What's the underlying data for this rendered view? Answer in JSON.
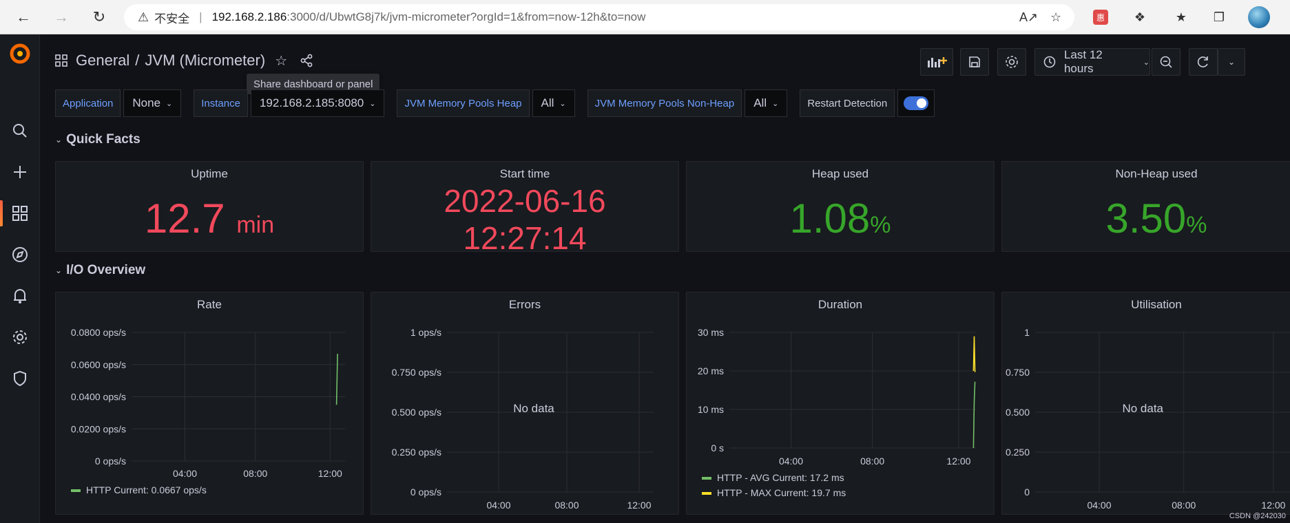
{
  "browser": {
    "insecure_label": "不安全",
    "url_host": "192.168.2.186",
    "url_path": ":3000/d/UbwtG8j7k/jvm-micrometer?orgId=1&from=now-12h&to=now",
    "ext_label": "惠"
  },
  "header": {
    "folder": "General",
    "title": "JVM (Micrometer)",
    "share_tooltip": "Share dashboard or panel",
    "time_range": "Last 12 hours"
  },
  "variables": [
    {
      "label": "Application",
      "value": "None"
    },
    {
      "label": "Instance",
      "value": "192.168.2.185:8080"
    },
    {
      "label": "JVM Memory Pools Heap",
      "value": "All"
    },
    {
      "label": "JVM Memory Pools Non-Heap",
      "value": "All"
    }
  ],
  "restart_detection": {
    "label": "Restart Detection",
    "enabled": true
  },
  "rows": {
    "quick_facts": "Quick Facts",
    "io_overview": "I/O Overview"
  },
  "stats": {
    "uptime": {
      "title": "Uptime",
      "value": "12.7",
      "unit": "min",
      "color": "#f2495c"
    },
    "start_time": {
      "title": "Start time",
      "line1": "2022-06-16",
      "line2": "12:27:14",
      "color": "#f2495c"
    },
    "heap_used": {
      "title": "Heap used",
      "value": "1.08",
      "unit": "%",
      "color": "#37a52a"
    },
    "nonheap_used": {
      "title": "Non-Heap used",
      "value": "3.50",
      "unit": "%",
      "color": "#37a52a"
    }
  },
  "chart_data": [
    {
      "type": "line",
      "title": "Rate",
      "x": [
        "04:00",
        "08:00",
        "12:00"
      ],
      "yticks": [
        "0.0800 ops/s",
        "0.0600 ops/s",
        "0.0400 ops/s",
        "0.0200 ops/s",
        "0 ops/s"
      ],
      "ylim": [
        0,
        0.08
      ],
      "series": [
        {
          "name": "HTTP",
          "legend": "HTTP  Current: 0.0667 ops/s",
          "color": "#73bf69",
          "points": [
            [
              0.96,
              0.035
            ],
            [
              0.965,
              0.0667
            ]
          ]
        }
      ]
    },
    {
      "type": "line",
      "title": "Errors",
      "x": [
        "04:00",
        "08:00",
        "12:00"
      ],
      "yticks": [
        "1 ops/s",
        "0.750 ops/s",
        "0.500 ops/s",
        "0.250 ops/s",
        "0 ops/s"
      ],
      "ylim": [
        0,
        1
      ],
      "no_data": "No data",
      "series": []
    },
    {
      "type": "line",
      "title": "Duration",
      "x": [
        "04:00",
        "08:00",
        "12:00"
      ],
      "yticks": [
        "30 ms",
        "20 ms",
        "10 ms",
        "0 s"
      ],
      "ylim": [
        0,
        30
      ],
      "series": [
        {
          "name": "HTTP - AVG",
          "legend": "HTTP - AVG  Current: 17.2 ms",
          "color": "#73bf69",
          "points": [
            [
              0.99,
              0
            ],
            [
              0.993,
              12
            ],
            [
              0.996,
              17.2
            ]
          ]
        },
        {
          "name": "HTTP - MAX",
          "legend": "HTTP - MAX  Current: 19.7 ms",
          "color": "#fade2a",
          "points": [
            [
              0.99,
              20
            ],
            [
              0.993,
              29
            ],
            [
              0.996,
              19.7
            ]
          ]
        }
      ]
    },
    {
      "type": "line",
      "title": "Utilisation",
      "x": [
        "04:00",
        "08:00",
        "12:00"
      ],
      "yticks": [
        "1",
        "0.750",
        "0.500",
        "0.250",
        "0"
      ],
      "ylim": [
        0,
        1
      ],
      "no_data": "No data",
      "series": []
    }
  ],
  "watermark": "CSDN @242030"
}
